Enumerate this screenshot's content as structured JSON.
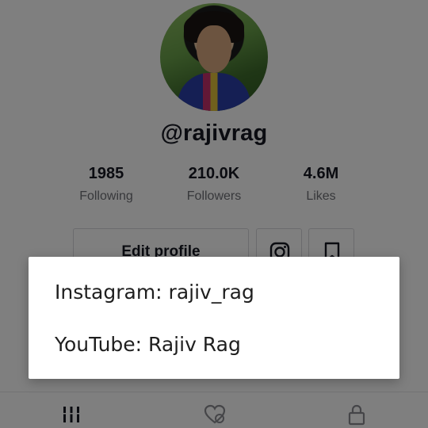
{
  "profile": {
    "username": "@rajivrag",
    "stats": [
      {
        "value": "1985",
        "label": "Following"
      },
      {
        "value": "210.0K",
        "label": "Followers"
      },
      {
        "value": "4.6M",
        "label": "Likes"
      }
    ],
    "edit_profile_label": "Edit profile",
    "icons": {
      "instagram": "instagram-icon",
      "bookmark": "bookmark-icon"
    }
  },
  "tabs": [
    {
      "icon": "videos-grid-icon"
    },
    {
      "icon": "liked-heart-icon"
    },
    {
      "icon": "private-lock-icon"
    }
  ],
  "dialog": {
    "items": [
      "Instagram: rajiv_rag",
      "YouTube: Rajiv Rag"
    ]
  },
  "colors": {
    "text_primary": "#161823",
    "text_secondary": "#6f7076",
    "overlay": "rgba(0,0,0,0.5)",
    "dialog_bg": "#ffffff"
  }
}
